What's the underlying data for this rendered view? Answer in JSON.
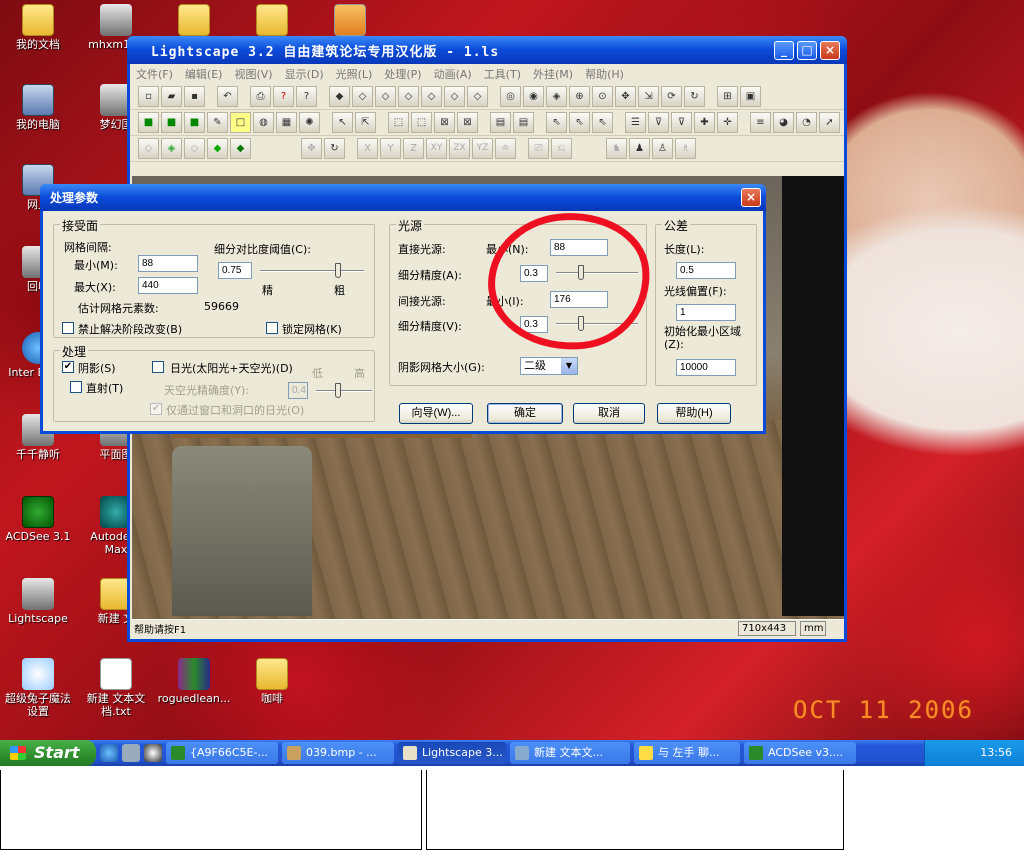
{
  "desktop": {
    "icons": [
      {
        "label": "我的文档",
        "kind": "folder"
      },
      {
        "label": "mhxm15e",
        "kind": "app"
      },
      {
        "label": "",
        "kind": "folder"
      },
      {
        "label": "",
        "kind": "folder"
      },
      {
        "label": "",
        "kind": "doc"
      },
      {
        "label": "我的电脑",
        "kind": "pc"
      },
      {
        "label": "梦幻国",
        "kind": "app"
      },
      {
        "label": "网上",
        "kind": "pc"
      },
      {
        "label": "回收",
        "kind": "app"
      },
      {
        "label": "Inter Explo",
        "kind": "ie"
      },
      {
        "label": "千千静听",
        "kind": "app"
      },
      {
        "label": "平面图",
        "kind": "app"
      },
      {
        "label": "ACDSee 3.1",
        "kind": "green"
      },
      {
        "label": "Autodesk Max",
        "kind": "teal"
      },
      {
        "label": "Lightscape",
        "kind": "app"
      },
      {
        "label": "新建 文",
        "kind": "folder"
      },
      {
        "label": "超级兔子魔法设置",
        "kind": "rabbit"
      },
      {
        "label": "新建 文本文档.txt",
        "kind": "doc"
      },
      {
        "label": "roguedlean...",
        "kind": "rar"
      },
      {
        "label": "咖啡",
        "kind": "folder"
      }
    ],
    "date_stamp": "OCT 11 2006"
  },
  "main_window": {
    "title": "Lightscape 3.2 自由建筑论坛专用汉化版  - 1.ls",
    "menu": [
      "文件(F)",
      "编辑(E)",
      "视图(V)",
      "显示(D)",
      "光照(L)",
      "处理(P)",
      "动画(A)",
      "工具(T)",
      "外挂(M)",
      "帮助(H)"
    ],
    "status_text": "帮助请按F1",
    "resolution": "710x443",
    "unit": "mm",
    "axis_buttons": [
      "X",
      "Y",
      "Z",
      "XY",
      "ZX",
      "YZ"
    ]
  },
  "dialog": {
    "title": "处理参数",
    "receiver": {
      "group": "接受面",
      "mesh_spacing": "网格间隔:",
      "min_label": "最小(M):",
      "min_value": "88",
      "max_label": "最大(X):",
      "max_value": "440",
      "contrast_label": "细分对比度阈值(C):",
      "contrast_value": "0.75",
      "fine": "精",
      "coarse": "粗",
      "estimate_label": "估计网格元素数:",
      "estimate_value": "59669",
      "disable_change": "禁止解决阶段改变(B)",
      "lock_mesh": "锁定网格(K)"
    },
    "process": {
      "group": "处理",
      "shadow": "阴影(S)",
      "daylight": "日光(太阳光+天空光)(D)",
      "direct": "直射(T)",
      "sky_precision": "天空光精确度(Y):",
      "sky_value": "0.4",
      "low": "低",
      "high": "高",
      "through_windows": "仅通过窗口和洞口的日光(O)"
    },
    "light": {
      "group": "光源",
      "direct_label": "直接光源:",
      "direct_min_label": "最小(N):",
      "direct_min_value": "88",
      "direct_precision_label": "细分精度(A):",
      "direct_precision_value": "0.3",
      "indirect_label": "间接光源:",
      "indirect_min_label": "最小(I):",
      "indirect_min_value": "176",
      "indirect_precision_label": "细分精度(V):",
      "indirect_precision_value": "0.3",
      "shadow_grid_label": "阴影网格大小(G):",
      "shadow_grid_value": "二级"
    },
    "tolerance": {
      "group": "公差",
      "length_label": "长度(L):",
      "length_value": "0.5",
      "light_offset_label": "光线偏置(F):",
      "light_offset_value": "1",
      "init_area_label": "初始化最小区域(Z):",
      "init_area_value": "10000"
    },
    "buttons": {
      "wizard": "向导(W)...",
      "ok": "确定",
      "cancel": "取消",
      "help": "帮助(H)"
    },
    "slider_levels": {
      "contrast": 0.75,
      "direct_precision": 0.3,
      "indirect_precision": 0.3,
      "sky_precision": 0.4
    }
  },
  "taskbar": {
    "start": "Start",
    "tasks": [
      "{A9F66C5E-...",
      "039.bmp - ...",
      "Lightscape 3...",
      "新建 文本文...",
      "与 左手 聊...",
      "ACDSee v3...."
    ],
    "clock": "13:56"
  }
}
